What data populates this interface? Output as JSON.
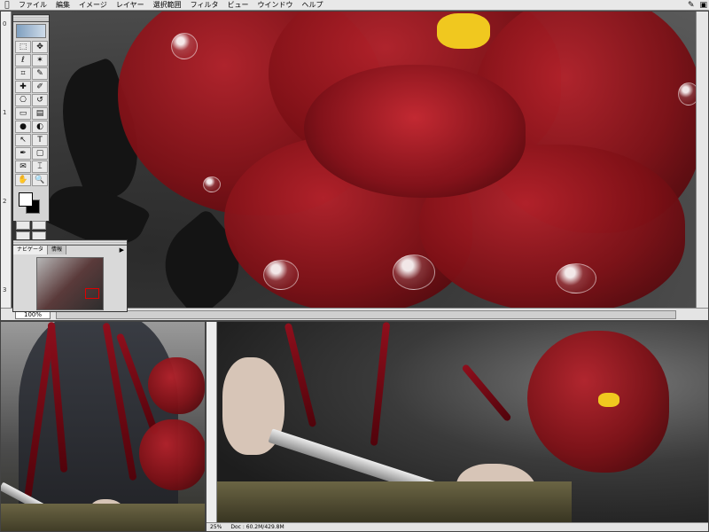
{
  "menubar": {
    "apple": "",
    "items": [
      "ファイル",
      "編集",
      "イメージ",
      "レイヤー",
      "選択範囲",
      "フィルタ",
      "ビュー",
      "ウインドウ",
      "ヘルプ"
    ],
    "right_icons": [
      "pen-icon",
      "app-icon"
    ]
  },
  "top_window": {
    "zoom": "100%",
    "ruler_marks": [
      "0",
      "1",
      "2",
      "3"
    ]
  },
  "navigator": {
    "tabs": [
      "ナビゲータ",
      "情報"
    ],
    "active_tab": 0
  },
  "bottom_right_window": {
    "zoom": "25%",
    "doc_info": "Doc : 60.2M/429.8M"
  },
  "toolbox": {
    "tools": [
      {
        "icon": "marquee-icon",
        "glyph": "⬚"
      },
      {
        "icon": "move-icon",
        "glyph": "✥"
      },
      {
        "icon": "lasso-icon",
        "glyph": "ℓ"
      },
      {
        "icon": "magic-wand-icon",
        "glyph": "✶"
      },
      {
        "icon": "crop-icon",
        "glyph": "⌗"
      },
      {
        "icon": "slice-icon",
        "glyph": "✎"
      },
      {
        "icon": "healing-brush-icon",
        "glyph": "✚"
      },
      {
        "icon": "brush-icon",
        "glyph": "✐"
      },
      {
        "icon": "stamp-icon",
        "glyph": "⎔"
      },
      {
        "icon": "history-brush-icon",
        "glyph": "↺"
      },
      {
        "icon": "eraser-icon",
        "glyph": "▭"
      },
      {
        "icon": "gradient-icon",
        "glyph": "▤"
      },
      {
        "icon": "blur-icon",
        "glyph": "●"
      },
      {
        "icon": "dodge-icon",
        "glyph": "◐"
      },
      {
        "icon": "path-select-icon",
        "glyph": "↖"
      },
      {
        "icon": "type-icon",
        "glyph": "T"
      },
      {
        "icon": "pen-tool-icon",
        "glyph": "✒"
      },
      {
        "icon": "shape-icon",
        "glyph": "▢"
      },
      {
        "icon": "notes-icon",
        "glyph": "✉"
      },
      {
        "icon": "eyedropper-icon",
        "glyph": "⌶"
      },
      {
        "icon": "hand-icon",
        "glyph": "✋"
      },
      {
        "icon": "zoom-icon",
        "glyph": "🔍"
      }
    ]
  }
}
